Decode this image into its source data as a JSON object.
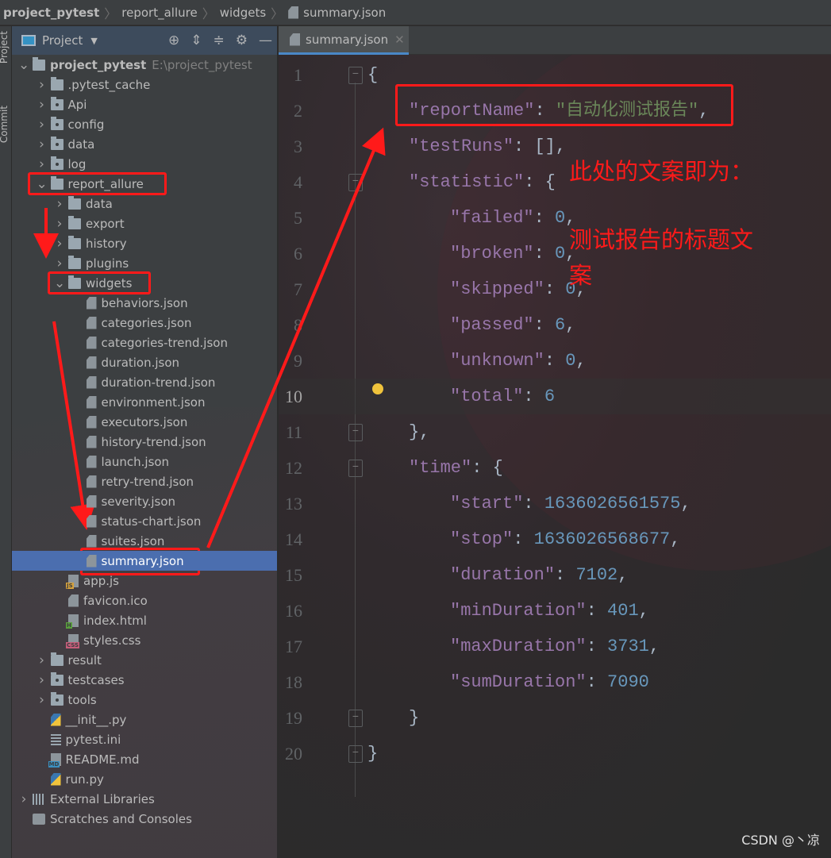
{
  "breadcrumb": [
    "project_pytest",
    "report_allure",
    "widgets",
    "summary.json"
  ],
  "left_strip": {
    "project_tab": "Project",
    "commit_tab": "Commit"
  },
  "panel": {
    "title": "Project",
    "tool_icons": [
      "locate-icon",
      "expand-all-icon",
      "collapse-all-icon",
      "gear-icon",
      "hide-icon"
    ]
  },
  "tree": [
    {
      "label": "project_pytest",
      "hint": "E:\\project_pytest",
      "level": 0,
      "type": "folder",
      "expanded": true,
      "bold": true
    },
    {
      "label": ".pytest_cache",
      "level": 1,
      "type": "folder",
      "expanded": false
    },
    {
      "label": "Api",
      "level": 1,
      "type": "pkg",
      "expanded": false
    },
    {
      "label": "config",
      "level": 1,
      "type": "pkg",
      "expanded": false
    },
    {
      "label": "data",
      "level": 1,
      "type": "pkg",
      "expanded": false
    },
    {
      "label": "log",
      "level": 1,
      "type": "pkg",
      "expanded": false
    },
    {
      "label": "report_allure",
      "level": 1,
      "type": "folder",
      "expanded": true
    },
    {
      "label": "data",
      "level": 2,
      "type": "folder",
      "expanded": false
    },
    {
      "label": "export",
      "level": 2,
      "type": "folder",
      "expanded": false
    },
    {
      "label": "history",
      "level": 2,
      "type": "folder",
      "expanded": false
    },
    {
      "label": "plugins",
      "level": 2,
      "type": "folder",
      "expanded": false
    },
    {
      "label": "widgets",
      "level": 2,
      "type": "folder",
      "expanded": true
    },
    {
      "label": "behaviors.json",
      "level": 3,
      "type": "json"
    },
    {
      "label": "categories.json",
      "level": 3,
      "type": "json"
    },
    {
      "label": "categories-trend.json",
      "level": 3,
      "type": "json"
    },
    {
      "label": "duration.json",
      "level": 3,
      "type": "json"
    },
    {
      "label": "duration-trend.json",
      "level": 3,
      "type": "json"
    },
    {
      "label": "environment.json",
      "level": 3,
      "type": "json"
    },
    {
      "label": "executors.json",
      "level": 3,
      "type": "json"
    },
    {
      "label": "history-trend.json",
      "level": 3,
      "type": "json"
    },
    {
      "label": "launch.json",
      "level": 3,
      "type": "json"
    },
    {
      "label": "retry-trend.json",
      "level": 3,
      "type": "json"
    },
    {
      "label": "severity.json",
      "level": 3,
      "type": "json"
    },
    {
      "label": "status-chart.json",
      "level": 3,
      "type": "json"
    },
    {
      "label": "suites.json",
      "level": 3,
      "type": "json"
    },
    {
      "label": "summary.json",
      "level": 3,
      "type": "json",
      "selected": true
    },
    {
      "label": "app.js",
      "level": 2,
      "type": "js"
    },
    {
      "label": "favicon.ico",
      "level": 2,
      "type": "ico"
    },
    {
      "label": "index.html",
      "level": 2,
      "type": "html"
    },
    {
      "label": "styles.css",
      "level": 2,
      "type": "css"
    },
    {
      "label": "result",
      "level": 1,
      "type": "folder",
      "expanded": false
    },
    {
      "label": "testcases",
      "level": 1,
      "type": "pkg",
      "expanded": false
    },
    {
      "label": "tools",
      "level": 1,
      "type": "pkg",
      "expanded": false
    },
    {
      "label": "__init__.py",
      "level": 1,
      "type": "py"
    },
    {
      "label": "pytest.ini",
      "level": 1,
      "type": "ini"
    },
    {
      "label": "README.md",
      "level": 1,
      "type": "md"
    },
    {
      "label": "run.py",
      "level": 1,
      "type": "py"
    },
    {
      "label": "External Libraries",
      "level": 0,
      "type": "lib",
      "expanded": false
    },
    {
      "label": "Scratches and Consoles",
      "level": 0,
      "type": "scratch"
    }
  ],
  "editor": {
    "tab_label": "summary.json",
    "current_line": 10,
    "lines": [
      {
        "indent": 0,
        "fold": "open",
        "tokens": [
          [
            "p",
            "{"
          ]
        ]
      },
      {
        "indent": 1,
        "tokens": [
          [
            "k",
            "\"reportName\""
          ],
          [
            "p",
            ": "
          ],
          [
            "s",
            "\"自动化测试报告\""
          ],
          [
            "p",
            ","
          ]
        ]
      },
      {
        "indent": 1,
        "tokens": [
          [
            "k",
            "\"testRuns\""
          ],
          [
            "p",
            ": [],"
          ]
        ]
      },
      {
        "indent": 1,
        "fold": "open",
        "tokens": [
          [
            "k",
            "\"statistic\""
          ],
          [
            "p",
            ": {"
          ]
        ]
      },
      {
        "indent": 2,
        "tokens": [
          [
            "k",
            "\"failed\""
          ],
          [
            "p",
            ": "
          ],
          [
            "n",
            "0"
          ],
          [
            "p",
            ","
          ]
        ]
      },
      {
        "indent": 2,
        "tokens": [
          [
            "k",
            "\"broken\""
          ],
          [
            "p",
            ": "
          ],
          [
            "n",
            "0"
          ],
          [
            "p",
            ","
          ]
        ]
      },
      {
        "indent": 2,
        "tokens": [
          [
            "k",
            "\"skipped\""
          ],
          [
            "p",
            ": "
          ],
          [
            "n",
            "0"
          ],
          [
            "p",
            ","
          ]
        ]
      },
      {
        "indent": 2,
        "tokens": [
          [
            "k",
            "\"passed\""
          ],
          [
            "p",
            ": "
          ],
          [
            "n",
            "6"
          ],
          [
            "p",
            ","
          ]
        ]
      },
      {
        "indent": 2,
        "tokens": [
          [
            "k",
            "\"unknown\""
          ],
          [
            "p",
            ": "
          ],
          [
            "n",
            "0"
          ],
          [
            "p",
            ","
          ]
        ]
      },
      {
        "indent": 2,
        "tokens": [
          [
            "k",
            "\"total\""
          ],
          [
            "p",
            ": "
          ],
          [
            "n",
            "6"
          ]
        ]
      },
      {
        "indent": 1,
        "fold": "close",
        "tokens": [
          [
            "p",
            "},"
          ]
        ]
      },
      {
        "indent": 1,
        "fold": "open",
        "tokens": [
          [
            "k",
            "\"time\""
          ],
          [
            "p",
            ": {"
          ]
        ]
      },
      {
        "indent": 2,
        "tokens": [
          [
            "k",
            "\"start\""
          ],
          [
            "p",
            ": "
          ],
          [
            "n",
            "1636026561575"
          ],
          [
            "p",
            ","
          ]
        ]
      },
      {
        "indent": 2,
        "tokens": [
          [
            "k",
            "\"stop\""
          ],
          [
            "p",
            ": "
          ],
          [
            "n",
            "1636026568677"
          ],
          [
            "p",
            ","
          ]
        ]
      },
      {
        "indent": 2,
        "tokens": [
          [
            "k",
            "\"duration\""
          ],
          [
            "p",
            ": "
          ],
          [
            "n",
            "7102"
          ],
          [
            "p",
            ","
          ]
        ]
      },
      {
        "indent": 2,
        "tokens": [
          [
            "k",
            "\"minDuration\""
          ],
          [
            "p",
            ": "
          ],
          [
            "n",
            "401"
          ],
          [
            "p",
            ","
          ]
        ]
      },
      {
        "indent": 2,
        "tokens": [
          [
            "k",
            "\"maxDuration\""
          ],
          [
            "p",
            ": "
          ],
          [
            "n",
            "3731"
          ],
          [
            "p",
            ","
          ]
        ]
      },
      {
        "indent": 2,
        "tokens": [
          [
            "k",
            "\"sumDuration\""
          ],
          [
            "p",
            ": "
          ],
          [
            "n",
            "7090"
          ]
        ]
      },
      {
        "indent": 1,
        "fold": "close",
        "tokens": [
          [
            "p",
            "}"
          ]
        ]
      },
      {
        "indent": 0,
        "fold": "close",
        "tokens": [
          [
            "p",
            "}"
          ]
        ]
      }
    ]
  },
  "annotations": {
    "line1": "此处的文案即为：",
    "line2": "测试报告的标题文",
    "line3": "案",
    "color": "#ff1a1a"
  },
  "watermark": "CSDN @丶凉"
}
